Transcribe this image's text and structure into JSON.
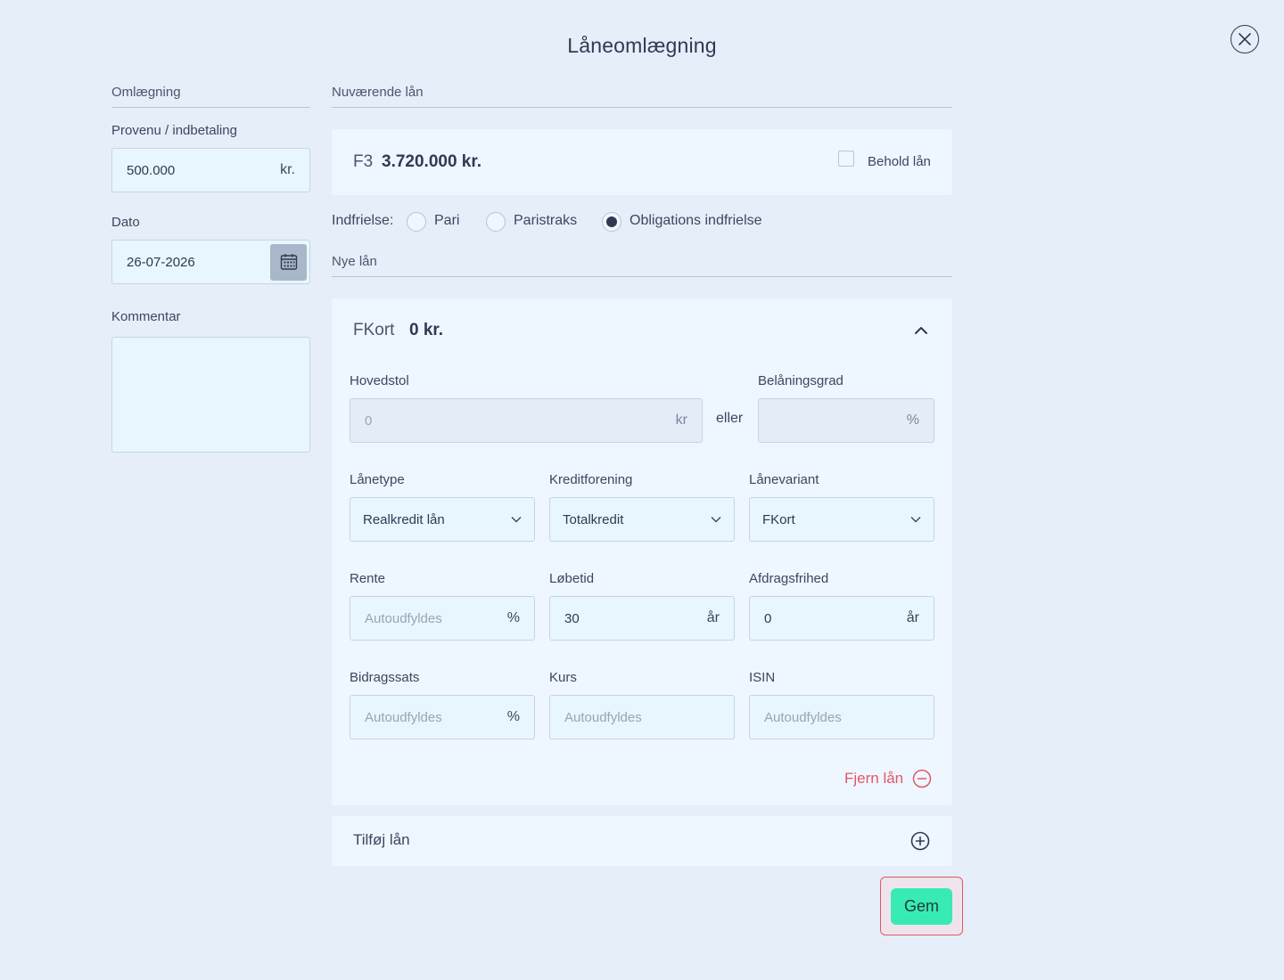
{
  "dialog": {
    "title": "Låneomlægning"
  },
  "left": {
    "section_title": "Omlægning",
    "provenu": {
      "label": "Provenu / indbetaling",
      "value": "500.000",
      "unit": "kr."
    },
    "dato": {
      "label": "Dato",
      "value": "26-07-2026"
    },
    "kommentar": {
      "label": "Kommentar",
      "value": ""
    }
  },
  "current": {
    "section_title": "Nuværende lån",
    "loan_type": "F3",
    "loan_amount": "3.720.000 kr.",
    "keep_label": "Behold lån",
    "keep_checked": false,
    "indfrielse_label": "Indfrielse:",
    "options": [
      {
        "label": "Pari",
        "selected": false
      },
      {
        "label": "Paristraks",
        "selected": false
      },
      {
        "label": "Obligations indfrielse",
        "selected": true
      }
    ]
  },
  "new_loans": {
    "section_title": "Nye lån",
    "loan": {
      "name": "FKort",
      "amount": "0 kr.",
      "hovedstol": {
        "label": "Hovedstol",
        "placeholder": "0",
        "unit": "kr"
      },
      "eller": "eller",
      "belaaningsgrad": {
        "label": "Belåningsgrad",
        "value": "",
        "unit": "%"
      },
      "laanetype": {
        "label": "Lånetype",
        "value": "Realkredit lån"
      },
      "kreditforening": {
        "label": "Kreditforening",
        "value": "Totalkredit"
      },
      "laanevariant": {
        "label": "Lånevariant",
        "value": "FKort"
      },
      "rente": {
        "label": "Rente",
        "placeholder": "Autoudfyldes",
        "unit": "%"
      },
      "loebetid": {
        "label": "Løbetid",
        "value": "30",
        "unit": "år"
      },
      "afdragsfrihed": {
        "label": "Afdragsfrihed",
        "value": "0",
        "unit": "år"
      },
      "bidragssats": {
        "label": "Bidragssats",
        "placeholder": "Autoudfyldes",
        "unit": "%"
      },
      "kurs": {
        "label": "Kurs",
        "placeholder": "Autoudfyldes"
      },
      "isin": {
        "label": "ISIN",
        "placeholder": "Autoudfyldes"
      },
      "remove_label": "Fjern lån"
    },
    "add_label": "Tilføj lån"
  },
  "footer": {
    "save_label": "Gem"
  },
  "colors": {
    "background": "#e6eef9",
    "accent_save": "#38ebb4",
    "danger": "#e05a66",
    "text": "#2f3a52"
  },
  "icons": [
    "close-icon",
    "calendar-icon",
    "chevron-down-icon",
    "chevron-up-icon",
    "minus-circle-icon",
    "plus-circle-icon"
  ]
}
